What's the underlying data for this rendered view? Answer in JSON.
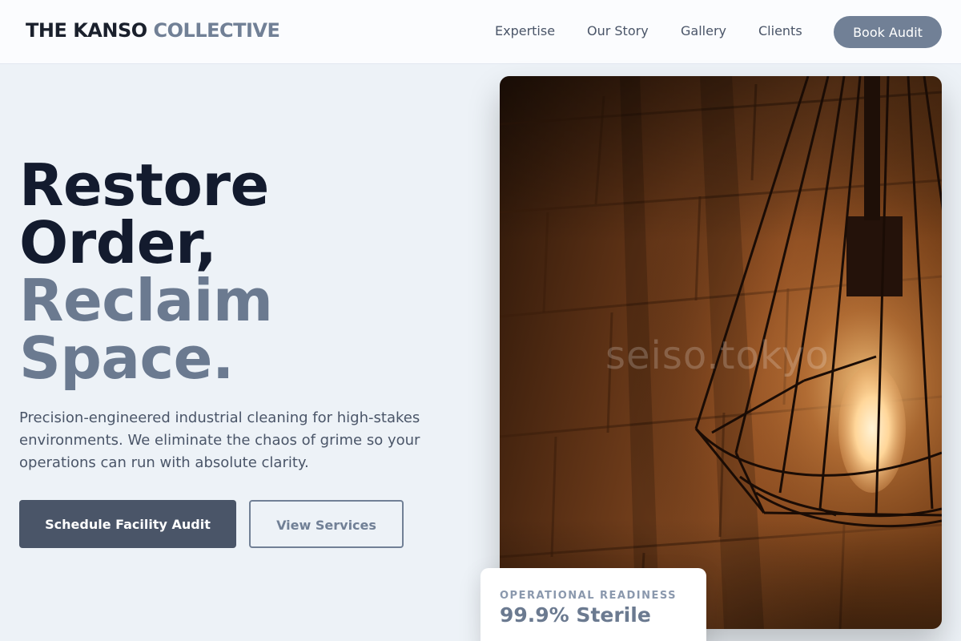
{
  "header": {
    "logo_primary": "THE KANSO",
    "logo_accent": "COLLECTIVE",
    "nav": [
      {
        "label": "Expertise"
      },
      {
        "label": "Our Story"
      },
      {
        "label": "Gallery"
      },
      {
        "label": "Clients"
      }
    ],
    "cta_label": "Book Audit"
  },
  "hero": {
    "headline_lines": [
      "Restore",
      "Order,",
      "Reclaim",
      "Space."
    ],
    "lead": "Precision-engineered industrial cleaning for high-stakes environments. We eliminate the chaos of grime so your operations can run with absolute clarity.",
    "primary_button": "Schedule Facility Audit",
    "secondary_button": "View Services"
  },
  "image": {
    "watermark": "seiso.tokyo"
  },
  "stat_card": {
    "label": "OPERATIONAL READINESS",
    "value": "99.9% Sterile"
  },
  "colors": {
    "dark_text": "#131b2e",
    "accent_gray": "#718096",
    "button_dark": "#4a5568",
    "background": "#edf2f7"
  }
}
